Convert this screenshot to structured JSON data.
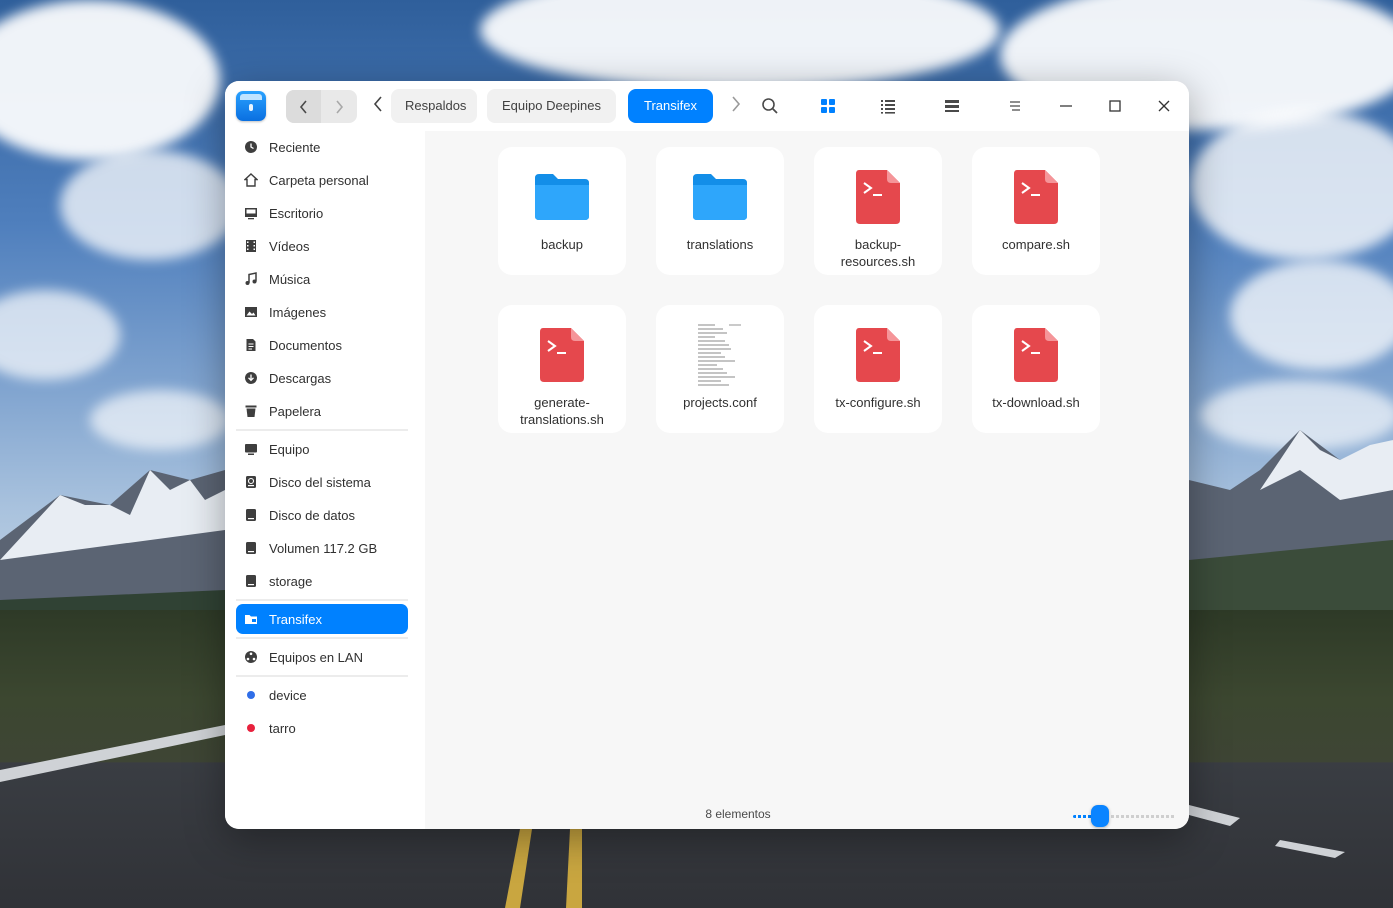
{
  "titlebar": {
    "nav_back": "‹",
    "nav_forward": "›",
    "breadcrumbs": [
      "Respaldos",
      "Equipo Deepines",
      "Transifex"
    ],
    "active_crumb": 2
  },
  "sidebar": {
    "places": [
      {
        "label": "Reciente",
        "icon": "clock-icon"
      },
      {
        "label": "Carpeta personal",
        "icon": "home-icon"
      },
      {
        "label": "Escritorio",
        "icon": "desktop-icon"
      },
      {
        "label": "Vídeos",
        "icon": "film-icon"
      },
      {
        "label": "Música",
        "icon": "music-note-icon"
      },
      {
        "label": "Imágenes",
        "icon": "image-icon"
      },
      {
        "label": "Documentos",
        "icon": "document-icon"
      },
      {
        "label": "Descargas",
        "icon": "download-icon"
      },
      {
        "label": "Papelera",
        "icon": "trash-icon"
      }
    ],
    "devices": [
      {
        "label": "Equipo",
        "icon": "computer-icon"
      },
      {
        "label": "Disco del sistema",
        "icon": "system-disk-icon"
      },
      {
        "label": "Disco de datos",
        "icon": "disk-icon"
      },
      {
        "label": "Volumen 117.2 GB",
        "icon": "disk-icon"
      },
      {
        "label": "storage",
        "icon": "disk-icon"
      }
    ],
    "bookmark": {
      "label": "Transifex",
      "icon": "folder-icon"
    },
    "network": {
      "label": "Equipos en LAN",
      "icon": "network-icon"
    },
    "tags": [
      {
        "label": "device",
        "color": "#2f6ee8"
      },
      {
        "label": "tarro",
        "color": "#e8213d"
      }
    ]
  },
  "files": [
    {
      "name": "backup",
      "type": "folder"
    },
    {
      "name": "translations",
      "type": "folder"
    },
    {
      "name": "backup-\nresources.sh",
      "type": "script"
    },
    {
      "name": "compare.sh",
      "type": "script"
    },
    {
      "name": "generate-\ntranslations.sh",
      "type": "script"
    },
    {
      "name": "projects.conf",
      "type": "text"
    },
    {
      "name": "tx-configure.sh",
      "type": "script"
    },
    {
      "name": "tx-download.sh",
      "type": "script"
    }
  ],
  "status": {
    "count_text": "8 elementos"
  },
  "zoom": {
    "level": 0.25
  },
  "colors": {
    "accent": "#0081ff",
    "script": "#e5484d",
    "folder": "#1d9bf0"
  }
}
